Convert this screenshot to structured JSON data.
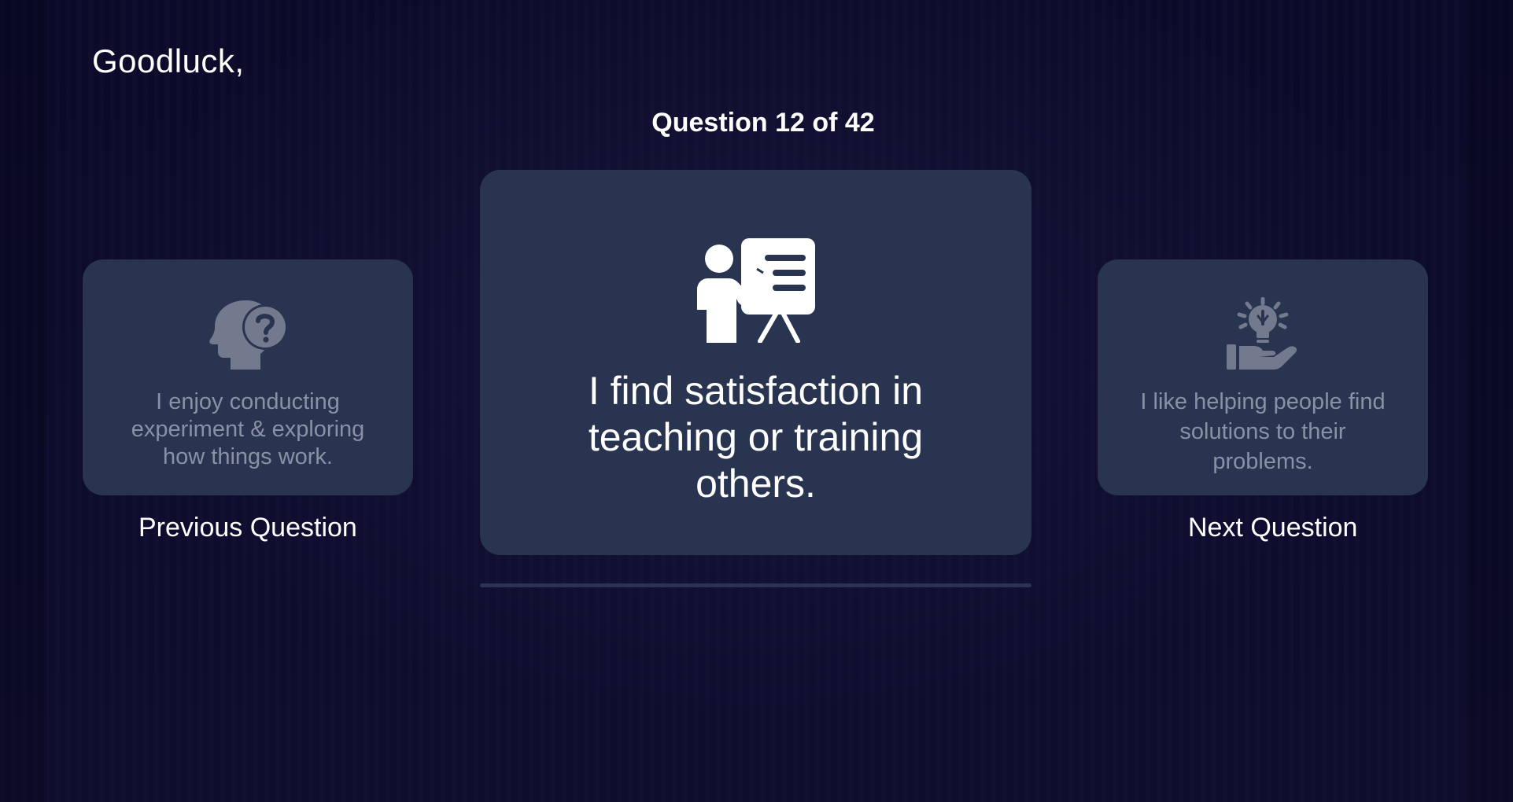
{
  "header": {
    "greeting": "Goodluck,",
    "question_counter": "Question 12 of 42"
  },
  "cards": {
    "previous": {
      "icon": "head-question-icon",
      "text": "I enjoy conducting experiment & exploring how things work."
    },
    "current": {
      "icon": "teacher-presentation-icon",
      "text": "I find satisfaction in teaching or training others."
    },
    "next": {
      "icon": "hand-lightbulb-icon",
      "text": "I like helping people find solutions to their problems."
    }
  },
  "navigation": {
    "previous_label": "Previous Question",
    "next_label": "Next Question"
  },
  "progress": {
    "current": 12,
    "total": 42
  },
  "colors": {
    "background": "#0b0a2a",
    "card": "#293450",
    "muted_text": "#8a91a4",
    "icon_muted": "#737a8e",
    "progress_track": "#2a3452"
  }
}
